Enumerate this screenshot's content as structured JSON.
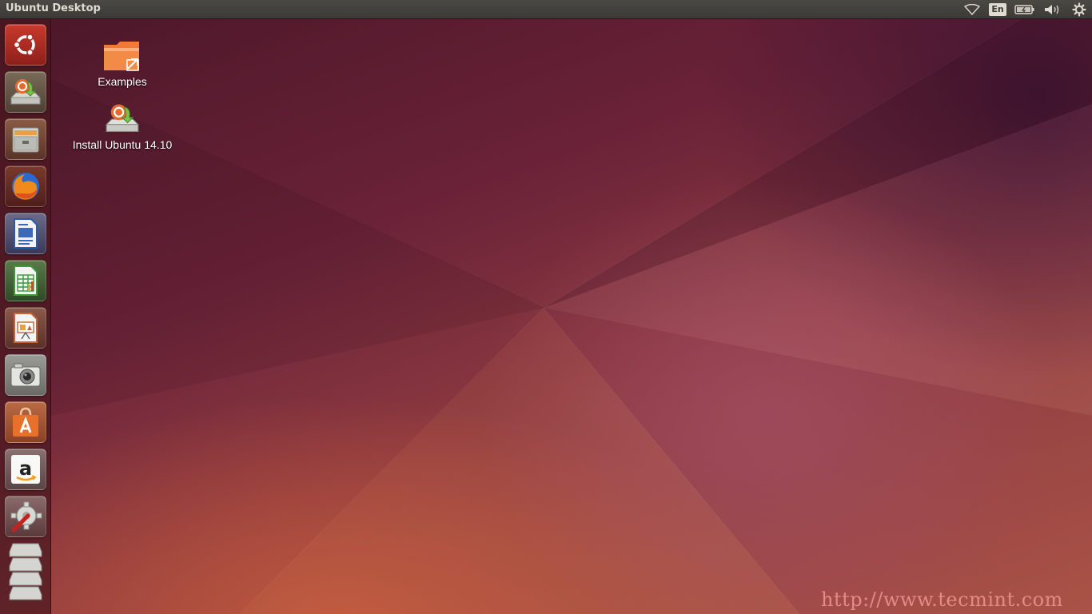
{
  "top_panel": {
    "title": "Ubuntu Desktop",
    "keyboard_layout": "En",
    "indicators": [
      "wifi-icon",
      "keyboard-layout",
      "battery-icon",
      "volume-icon",
      "session-gear-icon"
    ]
  },
  "launcher": {
    "items": [
      {
        "name": "dash-home",
        "icon": "ubuntu-logo-icon",
        "color": "#e05a2b"
      },
      {
        "name": "install-ubuntu",
        "icon": "installer-disk-icon",
        "color": "#4e7a3b"
      },
      {
        "name": "files",
        "icon": "file-cabinet-icon",
        "color": "#8a8a86"
      },
      {
        "name": "firefox",
        "icon": "firefox-icon",
        "color": "#e66000"
      },
      {
        "name": "libreoffice-writer",
        "icon": "writer-document-icon",
        "color": "#2a5aa8"
      },
      {
        "name": "libreoffice-calc",
        "icon": "calc-spreadsheet-icon",
        "color": "#3a9a3a"
      },
      {
        "name": "libreoffice-impress",
        "icon": "impress-presentation-icon",
        "color": "#c8643a"
      },
      {
        "name": "camera-app",
        "icon": "camera-icon",
        "color": "#9a9a96"
      },
      {
        "name": "ubuntu-software-center",
        "icon": "software-center-bag-icon",
        "color": "#e8702a"
      },
      {
        "name": "amazon",
        "icon": "amazon-logo-icon",
        "color": "#222222"
      },
      {
        "name": "system-settings",
        "icon": "settings-wrench-gear-icon",
        "color": "#b0201e"
      },
      {
        "name": "removable-drives",
        "icon": "drive-stack-icon",
        "color": "#b8b8b4"
      }
    ]
  },
  "desktop": {
    "icons": [
      {
        "label": "Examples",
        "icon": "folder-shortcut-icon"
      },
      {
        "label": "Install Ubuntu 14.10",
        "icon": "installer-disk-icon"
      }
    ]
  },
  "watermark": "http://www.tecmint.com",
  "colors": {
    "panel": "#3b3a36",
    "panel_text": "#dfdbd2",
    "wallpaper_dark": "#4a1628",
    "wallpaper_warm": "#b05a48",
    "watermark": "#e58a86"
  }
}
